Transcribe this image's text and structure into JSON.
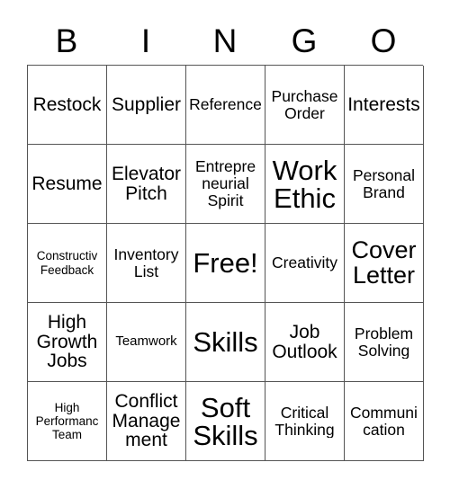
{
  "card": {
    "header_letters": [
      "B",
      "I",
      "N",
      "G",
      "O"
    ],
    "free_space_label": "Free!",
    "colors": {
      "background": "#ffffff",
      "text": "#000000",
      "grid_line": "#555555"
    },
    "rows": [
      [
        {
          "label": "Restock",
          "size": "lg",
          "clip": true
        },
        {
          "label": "Supplier",
          "size": "lg",
          "clip": true
        },
        {
          "label": "Reference",
          "size": "md",
          "clip": true
        },
        {
          "label": "Purchase Order",
          "size": "md",
          "clip": false
        },
        {
          "label": "Interests",
          "size": "lg",
          "clip": true
        }
      ],
      [
        {
          "label": "Resume",
          "size": "lg",
          "clip": true
        },
        {
          "label": "Elevator Pitch",
          "size": "lg",
          "clip": false
        },
        {
          "label": "Entrepre neurial Spirit",
          "size": "md",
          "clip": false
        },
        {
          "label": "Work Ethic",
          "size": "xxl",
          "clip": false
        },
        {
          "label": "Personal Brand",
          "size": "md",
          "clip": false
        }
      ],
      [
        {
          "label": "Constructiv Feedback",
          "size": "xs",
          "clip": false
        },
        {
          "label": "Inventory List",
          "size": "md",
          "clip": false
        },
        {
          "label": "Free!",
          "size": "xxl",
          "clip": true
        },
        {
          "label": "Creativity",
          "size": "md",
          "clip": true
        },
        {
          "label": "Cover Letter",
          "size": "xl",
          "clip": false
        }
      ],
      [
        {
          "label": "High Growth Jobs",
          "size": "lg",
          "clip": false
        },
        {
          "label": "Teamwork",
          "size": "sm",
          "clip": true
        },
        {
          "label": "Skills",
          "size": "xxl",
          "clip": true
        },
        {
          "label": "Job Outlook",
          "size": "lg",
          "clip": false
        },
        {
          "label": "Problem Solving",
          "size": "md",
          "clip": false
        }
      ],
      [
        {
          "label": "High Performanc Team",
          "size": "xs",
          "clip": false
        },
        {
          "label": "Conflict Manage ment",
          "size": "lg",
          "clip": false
        },
        {
          "label": "Soft Skills",
          "size": "xxl",
          "clip": false
        },
        {
          "label": "Critical Thinking",
          "size": "md",
          "clip": false
        },
        {
          "label": "Communi cation",
          "size": "md",
          "clip": false
        }
      ]
    ]
  }
}
